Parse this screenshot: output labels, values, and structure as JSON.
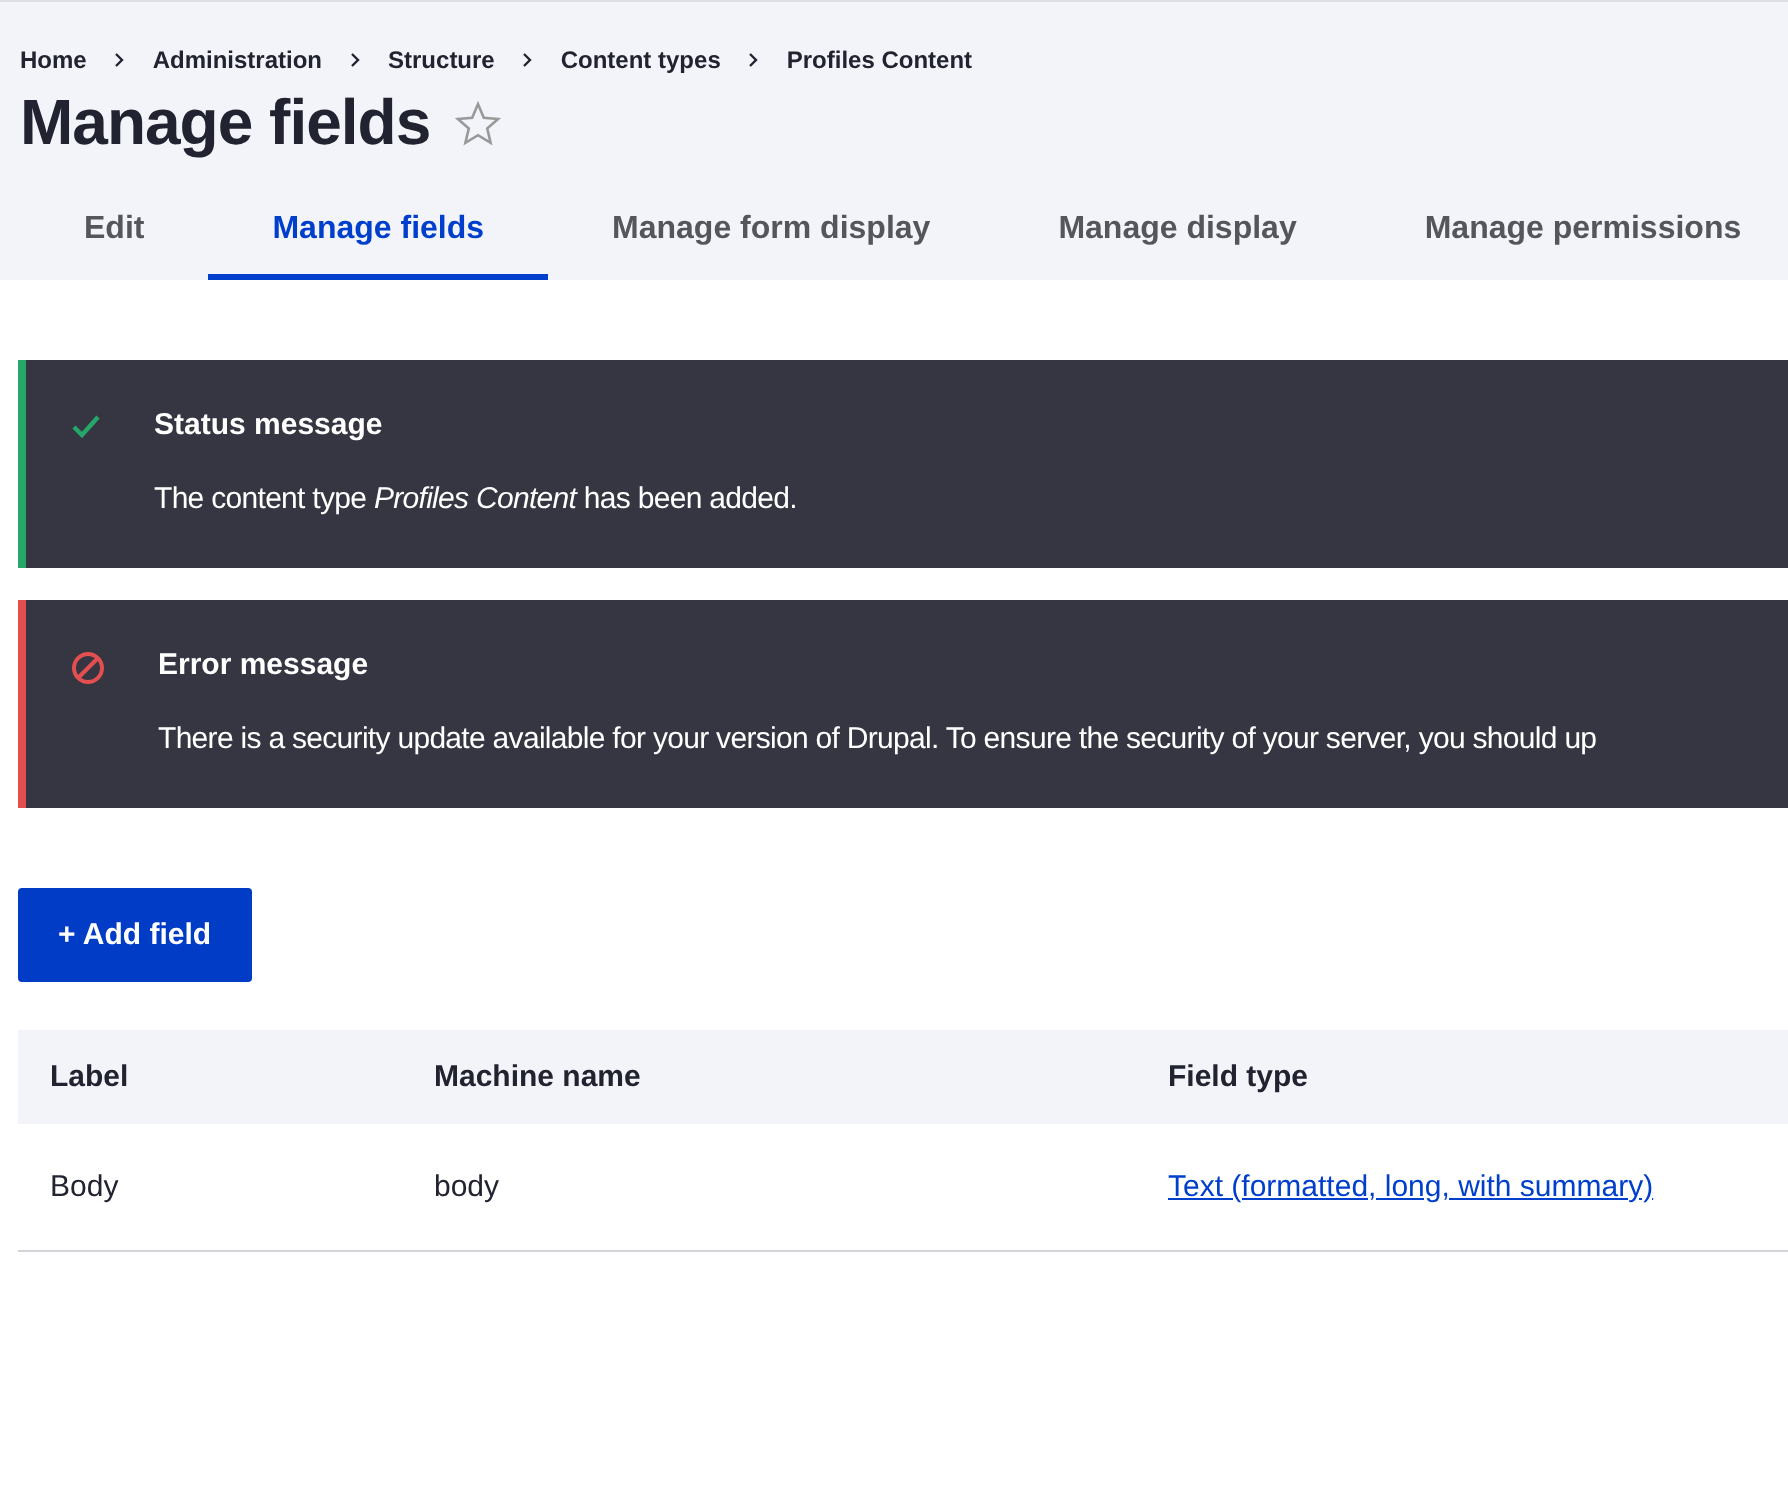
{
  "breadcrumb": [
    "Home",
    "Administration",
    "Structure",
    "Content types",
    "Profiles Content"
  ],
  "page_title": "Manage fields",
  "tabs": [
    {
      "label": "Edit",
      "selected": false
    },
    {
      "label": "Manage fields",
      "selected": true
    },
    {
      "label": "Manage form display",
      "selected": false
    },
    {
      "label": "Manage display",
      "selected": false
    },
    {
      "label": "Manage permissions",
      "selected": false
    }
  ],
  "messages": [
    {
      "kind": "status",
      "title": "Status message",
      "text": "The content type *Profiles Content* has been added."
    },
    {
      "kind": "error",
      "title": "Error message",
      "text": "There is a security update available for your version of Drupal. To ensure the security of your server, you should up"
    }
  ],
  "add_button": "+ Add field",
  "table": {
    "columns": [
      "Label",
      "Machine name",
      "Field type"
    ],
    "rows": [
      {
        "label": "Body",
        "machine_name": "body",
        "field_type": "Text (formatted, long, with summary)"
      }
    ]
  }
}
